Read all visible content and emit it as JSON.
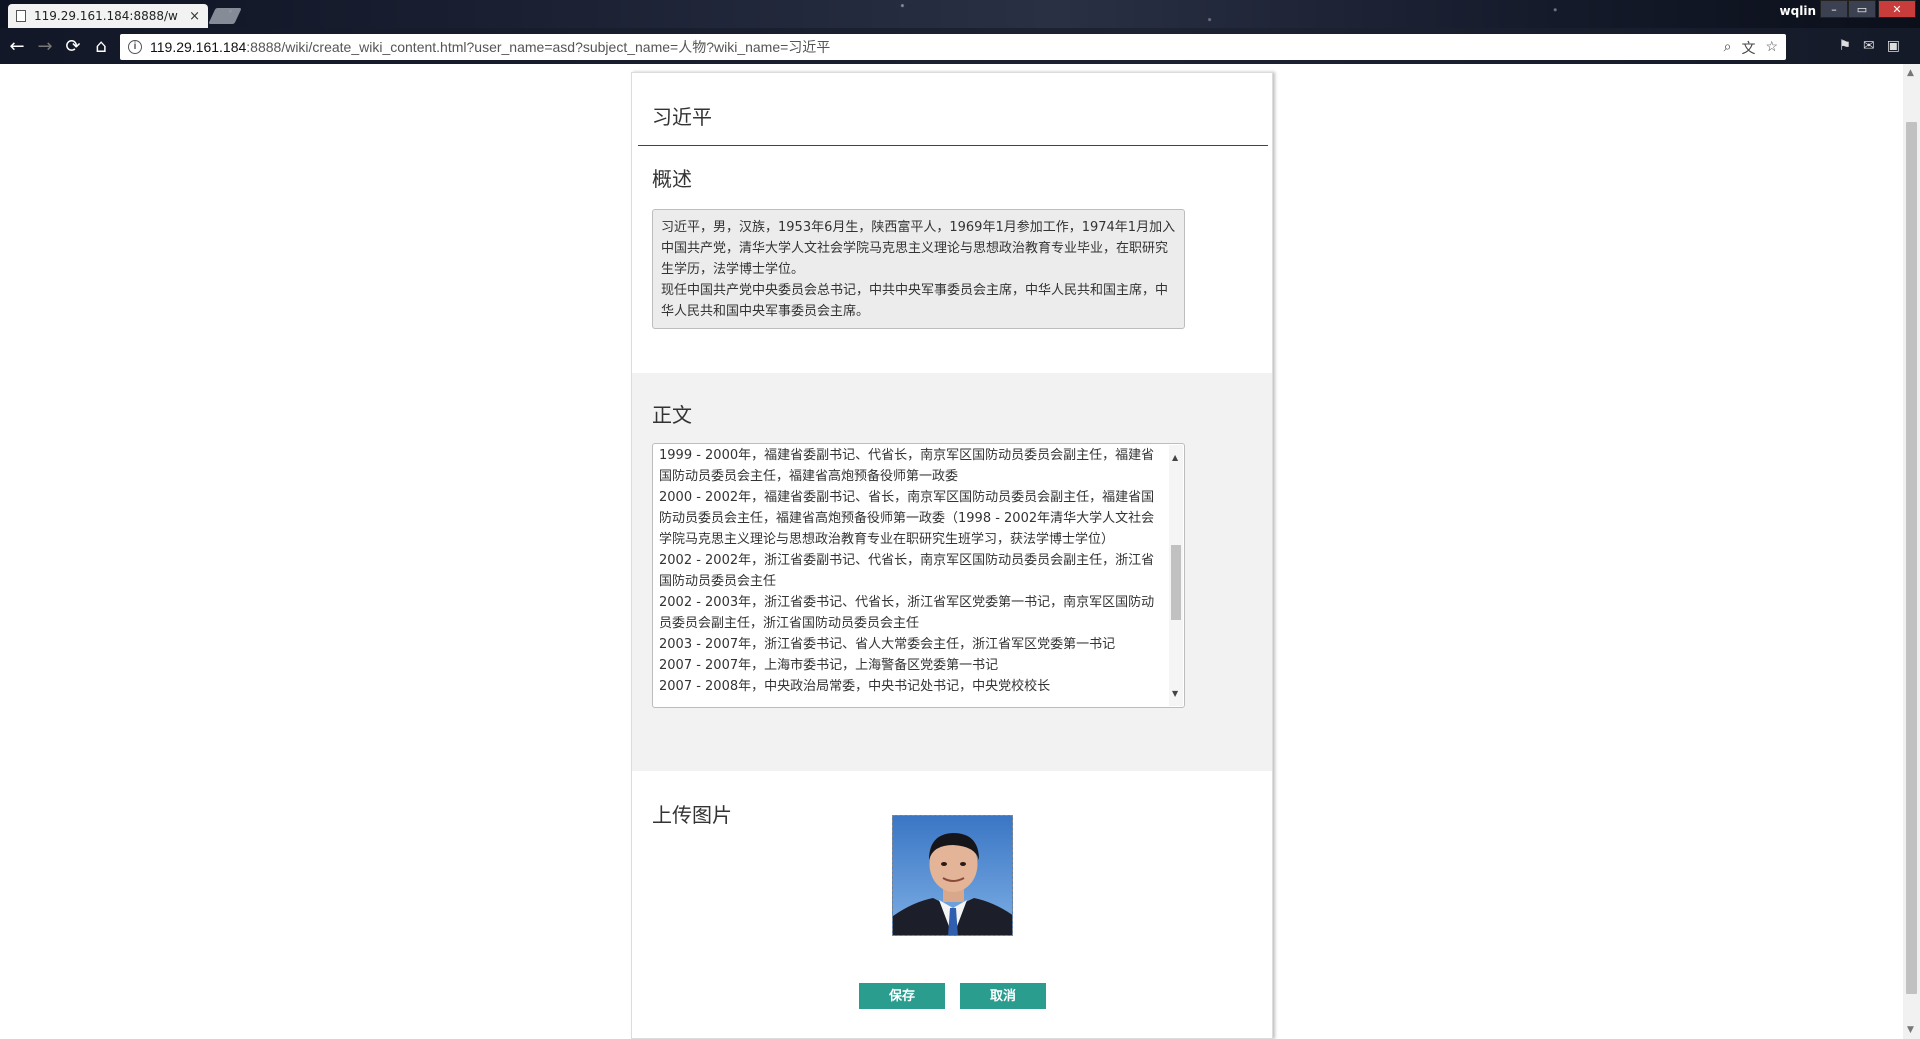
{
  "browser": {
    "tab_title": "119.29.161.184:8888/w",
    "tab_close": "×",
    "user_name": "wqlin",
    "url_host": "119.29.161.184",
    "url_path": ":8888/wiki/create_wiki_content.html?user_name=asd?subject_name=人物?wiki_name=习近平",
    "nav": {
      "back": "←",
      "forward": "→",
      "reload": "⟳",
      "home": "⌂"
    },
    "omnibox_icons": {
      "zoom": "⌕",
      "translate": "文",
      "bookmark": "☆"
    },
    "window_buttons": {
      "minimize": "–",
      "maximize": "▭",
      "close": "✕"
    },
    "extension_icons": [
      "flag-extension-icon",
      "mail-extension-icon",
      "puzzle-extension-icon"
    ]
  },
  "wiki": {
    "title": "习近平",
    "summary_heading": "概述",
    "summary_lines": [
      "习近平，男，汉族，1953年6月生，陕西富平人，1969年1月参加工作，1974年1月加入中国共产党，清华大学人文社会学院马克思主义理论与思想政治教育专业毕业，在职研究生学历，法学博士学位。",
      "现任中国共产党中央委员会总书记，中共中央军事委员会主席，中华人民共和国主席，中华人民共和国中央军事委员会主席。"
    ],
    "body_heading": "正文",
    "body_lines": [
      "1999 - 2000年，福建省委副书记、代省长，南京军区国防动员委员会副主任，福建省国防动员委员会主任，福建省高炮预备役师第一政委",
      "2000 - 2002年，福建省委副书记、省长，南京军区国防动员委员会副主任，福建省国防动员委员会主任，福建省高炮预备役师第一政委（1998 - 2002年清华大学人文社会学院马克思主义理论与思想政治教育专业在职研究生班学习，获法学博士学位）",
      "2002 - 2002年，浙江省委副书记、代省长，南京军区国防动员委员会副主任，浙江省国防动员委员会主任",
      "2002 - 2003年，浙江省委书记、代省长，浙江省军区党委第一书记，南京军区国防动员委员会副主任，浙江省国防动员委员会主任",
      "2003 - 2007年，浙江省委书记、省人大常委会主任，浙江省军区党委第一书记",
      "2007 - 2007年，上海市委书记，上海警备区党委第一书记",
      "2007 - 2008年，中央政治局常委，中央书记处书记，中央党校校长"
    ],
    "upload_heading": "上传图片",
    "save_label": "保存",
    "cancel_label": "取消"
  }
}
